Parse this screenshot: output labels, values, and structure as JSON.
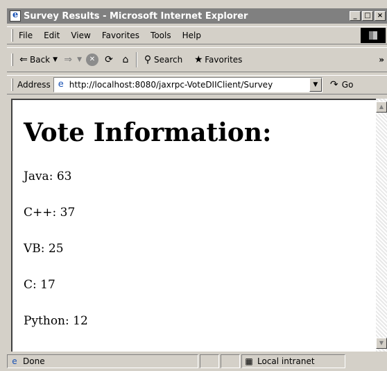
{
  "window": {
    "title": "Survey Results - Microsoft Internet Explorer",
    "minimize": "_",
    "maximize": "□",
    "close": "×"
  },
  "menu": {
    "items": [
      "File",
      "Edit",
      "View",
      "Favorites",
      "Tools",
      "Help"
    ]
  },
  "toolbar": {
    "back_label": "Back",
    "search_label": "Search",
    "favorites_label": "Favorites",
    "more_chevron": "»"
  },
  "address": {
    "label": "Address",
    "url": "http://localhost:8080/jaxrpc-VoteDIIClient/Survey",
    "go_label": "Go"
  },
  "page": {
    "heading": "Vote Information:",
    "votes": [
      {
        "text": "Java: 63"
      },
      {
        "text": "C++: 37"
      },
      {
        "text": "VB: 25"
      },
      {
        "text": "C: 17"
      },
      {
        "text": "Python: 12"
      }
    ]
  },
  "status": {
    "text": "Done",
    "zone": "Local intranet"
  }
}
